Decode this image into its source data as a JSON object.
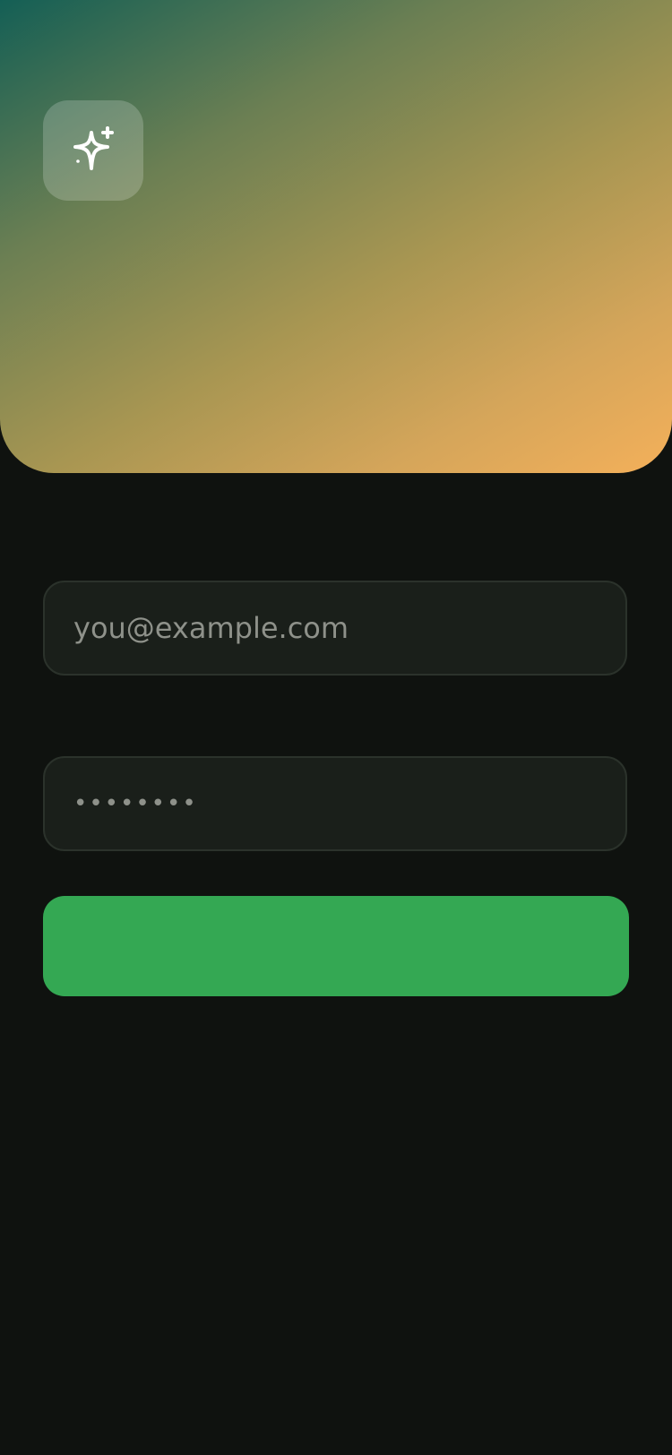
{
  "colors": {
    "background": "#0f120f",
    "hero_gradient": [
      "#145f55",
      "#6b7f53",
      "#a89652",
      "#d4a55a",
      "#f4b05a"
    ],
    "field_background": "#1a1f1a",
    "field_border": "#2b322b",
    "placeholder": "#8e918a",
    "primary_button": "#34a853"
  },
  "hero": {
    "icon": "sparkles-icon"
  },
  "form": {
    "email_placeholder": "you@example.com",
    "email_value": "",
    "password_placeholder": "••••••••",
    "password_value": "",
    "submit_label": ""
  }
}
